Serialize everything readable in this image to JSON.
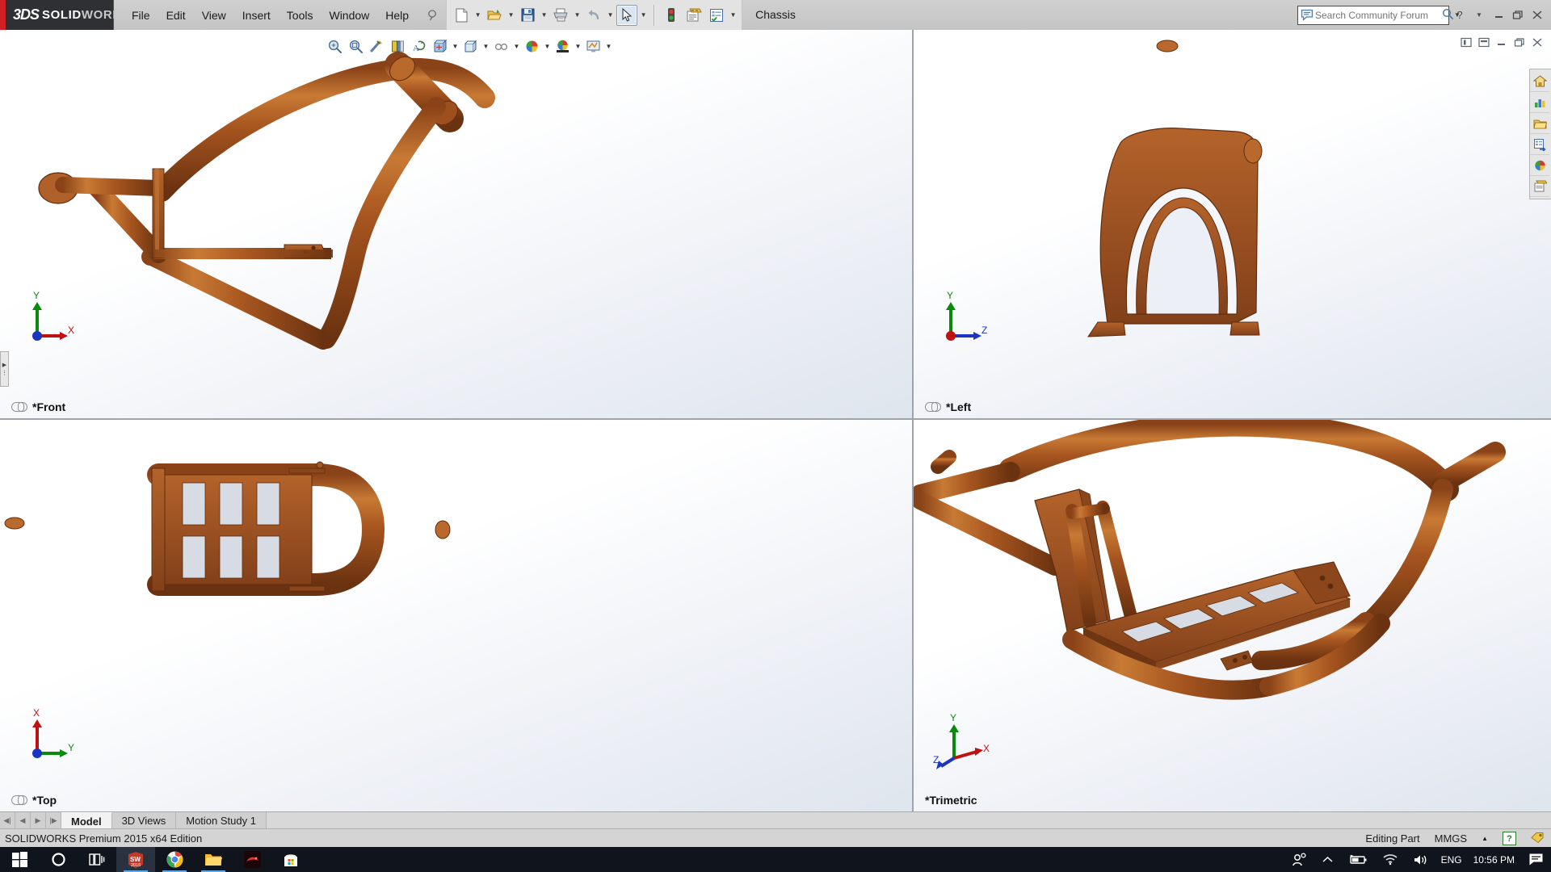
{
  "app": {
    "brand_3ds": "3DS",
    "brand_main": "SOLID",
    "brand_dim": "WORKS",
    "document_title": "Chassis",
    "edition": "SOLIDWORKS Premium 2015 x64 Edition"
  },
  "menu": {
    "items": [
      {
        "label": "File"
      },
      {
        "label": "Edit"
      },
      {
        "label": "View"
      },
      {
        "label": "Insert"
      },
      {
        "label": "Tools"
      },
      {
        "label": "Window"
      },
      {
        "label": "Help"
      }
    ],
    "pin_icon": "pushpin-icon"
  },
  "toolbar": {
    "buttons": [
      {
        "name": "new-document-icon",
        "caret": true
      },
      {
        "name": "open-document-icon",
        "caret": true
      },
      {
        "name": "save-icon",
        "caret": true
      },
      {
        "name": "print-icon",
        "caret": true
      },
      {
        "name": "undo-icon",
        "caret": true
      },
      {
        "name": "select-cursor-icon",
        "caret": true,
        "pressed": true
      },
      {
        "name": "rebuild-traffic-light-icon",
        "caret": false
      },
      {
        "name": "file-properties-icon",
        "caret": false
      },
      {
        "name": "options-icon",
        "caret": true
      }
    ]
  },
  "search": {
    "placeholder": "Search Community Forum",
    "value": "",
    "forum_icon": "speech-bubble-icon",
    "magnifier_icon": "magnifier-icon",
    "caret_icon": "chevron-down-icon"
  },
  "window_controls": {
    "help": "?",
    "help_caret": "chevron-down-icon",
    "minimize": "minimize-icon",
    "restore": "restore-icon",
    "close": "close-icon"
  },
  "viewport_controls": {
    "buttons": [
      {
        "name": "split-vertical-icon"
      },
      {
        "name": "split-horizontal-icon"
      },
      {
        "name": "minimize-view-icon"
      },
      {
        "name": "restore-view-icon"
      },
      {
        "name": "close-view-icon"
      }
    ]
  },
  "headsup_toolbar": {
    "buttons": [
      {
        "name": "zoom-to-fit-icon",
        "caret": false
      },
      {
        "name": "zoom-to-area-icon",
        "caret": false
      },
      {
        "name": "previous-view-icon",
        "caret": false
      },
      {
        "name": "section-view-icon",
        "caret": false
      },
      {
        "name": "view-orientation-icon",
        "caret": false
      },
      {
        "name": "display-style-icon",
        "caret": true
      },
      {
        "name": "hide-show-items-icon",
        "caret": true
      },
      {
        "name": "edit-appearance-icon",
        "caret": true
      },
      {
        "name": "apply-scene-icon",
        "caret": true
      },
      {
        "name": "view-settings-icon",
        "caret": true
      }
    ]
  },
  "task_pane": {
    "tabs": [
      {
        "name": "solidworks-resources-icon"
      },
      {
        "name": "design-library-icon"
      },
      {
        "name": "file-explorer-icon"
      },
      {
        "name": "view-palette-icon"
      },
      {
        "name": "appearances-scenes-icon"
      },
      {
        "name": "custom-properties-icon"
      }
    ]
  },
  "viewports": [
    {
      "id": "front",
      "label": "*Front",
      "link_icon": "linked-views-icon",
      "triad": {
        "x": "X",
        "y": "Y",
        "z": "Z"
      }
    },
    {
      "id": "left",
      "label": "*Left",
      "link_icon": "linked-views-icon",
      "triad": {
        "x": "X",
        "y": "Y",
        "z": "Z"
      }
    },
    {
      "id": "top",
      "label": "*Top",
      "link_icon": "linked-views-icon",
      "triad": {
        "x": "X",
        "y": "Y",
        "z": "Z"
      }
    },
    {
      "id": "trimetric",
      "label": "*Trimetric",
      "link_icon": "",
      "triad": {
        "x": "X",
        "y": "Y",
        "z": "Z"
      }
    }
  ],
  "tab_bar": {
    "nav": [
      "first-tab-icon",
      "previous-tab-icon",
      "next-tab-icon",
      "last-tab-icon"
    ],
    "tabs": [
      {
        "label": "Model",
        "active": true
      },
      {
        "label": "3D Views",
        "active": false
      },
      {
        "label": "Motion Study 1",
        "active": false
      }
    ]
  },
  "status_bar": {
    "edition": "SOLIDWORKS Premium 2015 x64 Edition",
    "mode": "Editing Part",
    "units": "MMGS",
    "units_caret": "chevron-up-icon",
    "help_badge": "?",
    "tag_icon": "tag-icon"
  },
  "taskbar": {
    "items": [
      {
        "name": "start-button-icon",
        "label": "Start"
      },
      {
        "name": "cortana-search-icon",
        "label": "Cortana"
      },
      {
        "name": "task-view-icon",
        "label": "Task View"
      },
      {
        "name": "solidworks-taskbar-icon",
        "label": "SOLIDWORKS 2015",
        "active": true,
        "running": true
      },
      {
        "name": "chrome-taskbar-icon",
        "label": "Google Chrome",
        "running": true
      },
      {
        "name": "file-explorer-taskbar-icon",
        "label": "File Explorer",
        "running": true
      },
      {
        "name": "red-app-taskbar-icon",
        "label": "App"
      },
      {
        "name": "microsoft-store-icon",
        "label": "Microsoft Store"
      }
    ],
    "tray": [
      {
        "name": "people-icon"
      },
      {
        "name": "show-hidden-icons-icon"
      },
      {
        "name": "battery-icon"
      },
      {
        "name": "wifi-icon"
      },
      {
        "name": "volume-icon"
      }
    ],
    "language": "ENG",
    "clock": "10:56 PM",
    "notifications_icon": "action-center-icon"
  },
  "model": {
    "color_tube": "#9b4f1e",
    "color_tube_light": "#c4732f",
    "color_tube_dark": "#6d3512",
    "color_plate": "#a8541f",
    "name": "Chassis"
  }
}
